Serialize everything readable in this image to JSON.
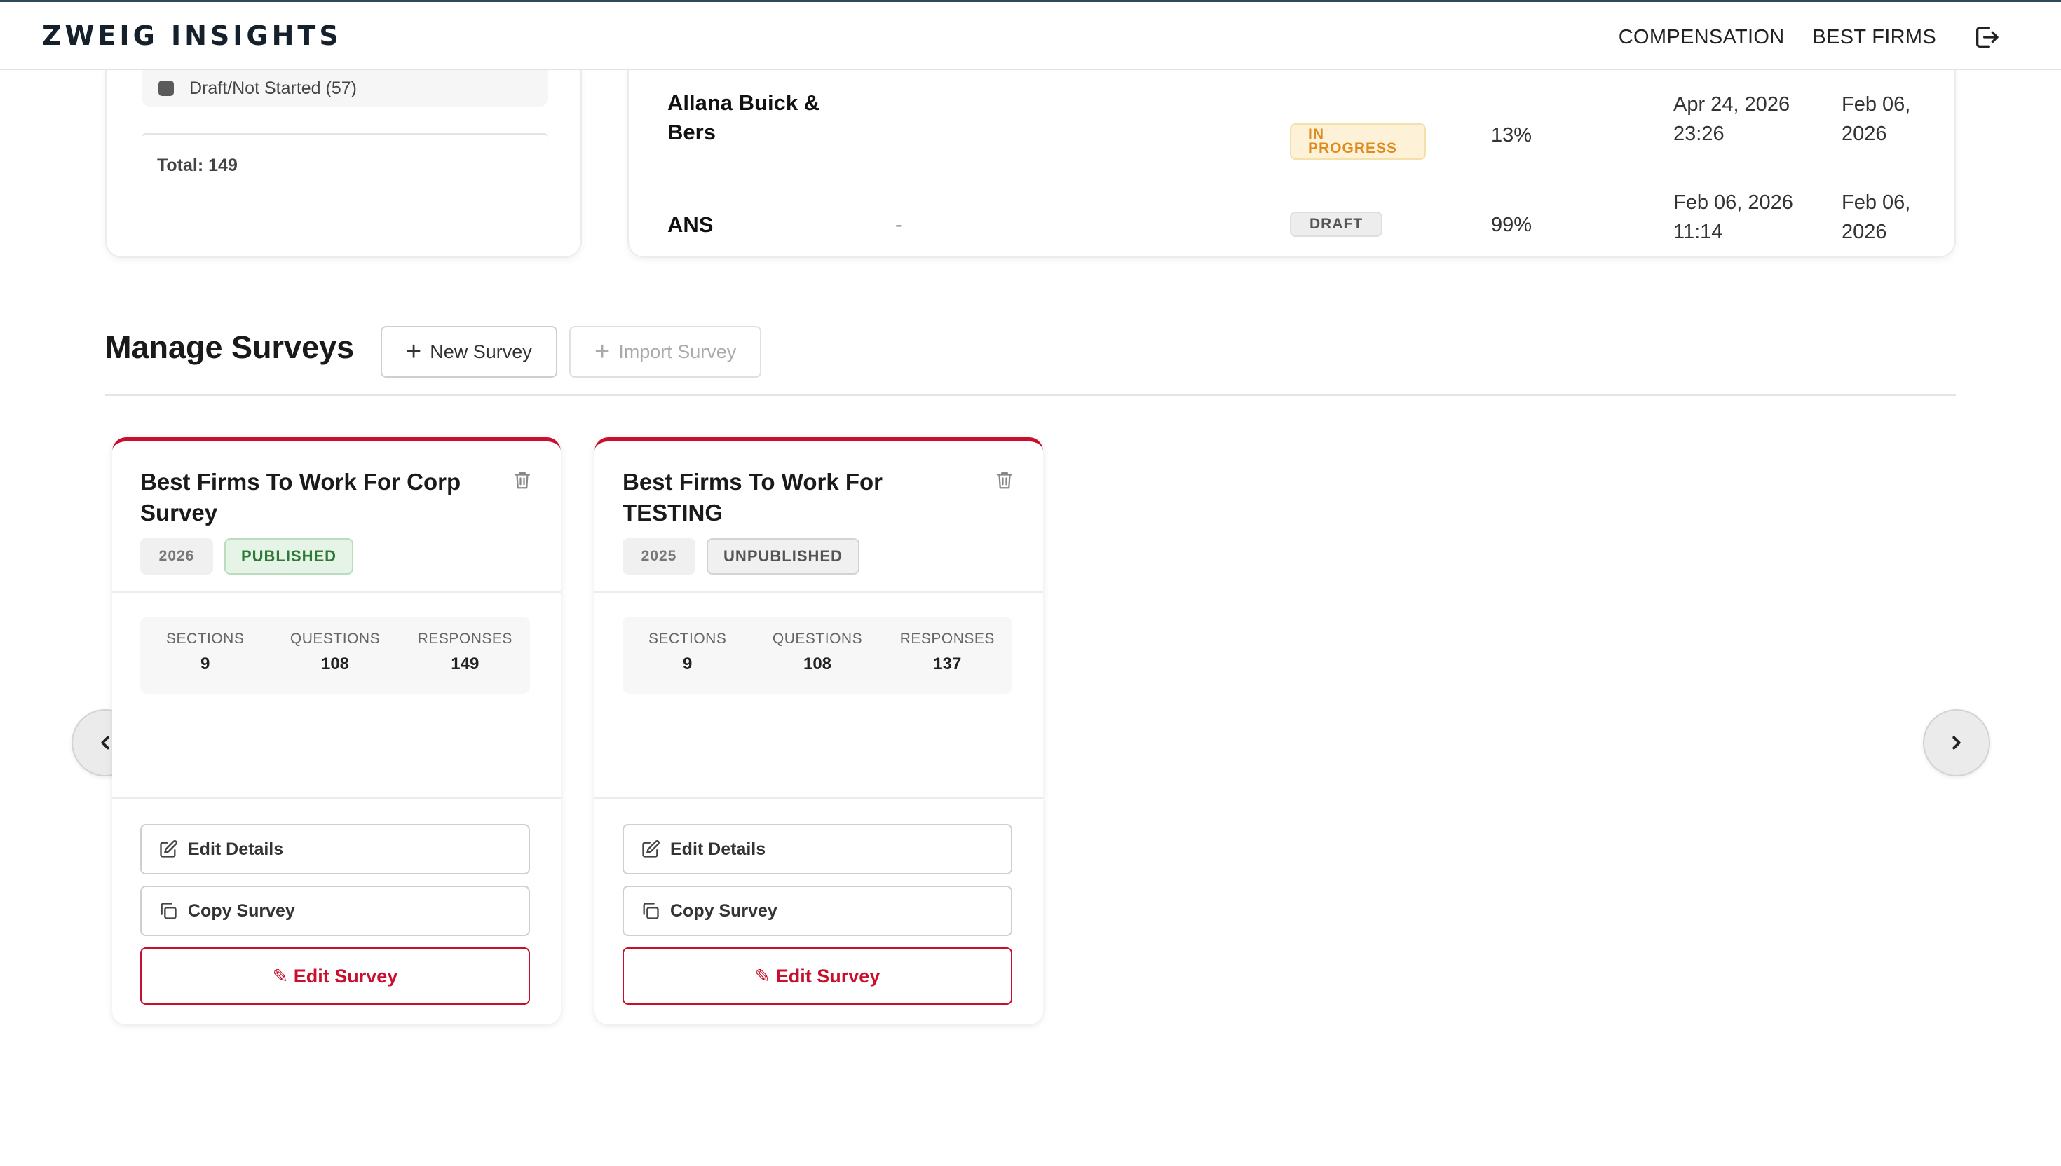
{
  "header": {
    "brand": "ZWEIG INSIGHTS",
    "nav": {
      "compensation": "COMPENSATION",
      "best_firms": "BEST FIRMS"
    },
    "logout_icon": "logout-icon"
  },
  "status_summary": {
    "legend_item": "Draft/Not Started (57)",
    "legend_color": "#5a5a5a",
    "total": "Total: 149"
  },
  "responses_table": {
    "rows": [
      {
        "name": "Allana Buick & Bers",
        "contact": "",
        "status": "IN PROGRESS",
        "progress": "13%",
        "last_updated": "Apr 24, 2026 23:26",
        "created": "Feb 06, 2026"
      },
      {
        "name": "ANS",
        "contact": "-",
        "status": "DRAFT",
        "progress": "99%",
        "last_updated": "Feb 06, 2026 11:14",
        "created": "Feb 06, 2026"
      }
    ]
  },
  "manage_surveys": {
    "title": "Manage Surveys",
    "new_survey": "New Survey",
    "import_survey": "Import Survey"
  },
  "surveys": [
    {
      "title": "Best Firms To Work For Corp Survey",
      "year": "2026",
      "status": "PUBLISHED",
      "stats": {
        "sections_label": "SECTIONS",
        "sections": "9",
        "questions_label": "QUESTIONS",
        "questions": "108",
        "responses_label": "RESPONSES",
        "responses": "149"
      },
      "edit_details": "Edit Details",
      "copy_survey": "Copy Survey",
      "edit_survey": "✎ Edit Survey"
    },
    {
      "title": "Best Firms To Work For TESTING",
      "year": "2025",
      "status": "UNPUBLISHED",
      "stats": {
        "sections_label": "SECTIONS",
        "sections": "9",
        "questions_label": "QUESTIONS",
        "questions": "108",
        "responses_label": "RESPONSES",
        "responses": "137"
      },
      "edit_details": "Edit Details",
      "copy_survey": "Copy Survey",
      "edit_survey": "✎ Edit Survey"
    }
  ],
  "colors": {
    "accent": "#c8102e",
    "published": "#2f7a36",
    "in_progress": "#e08a1e"
  }
}
